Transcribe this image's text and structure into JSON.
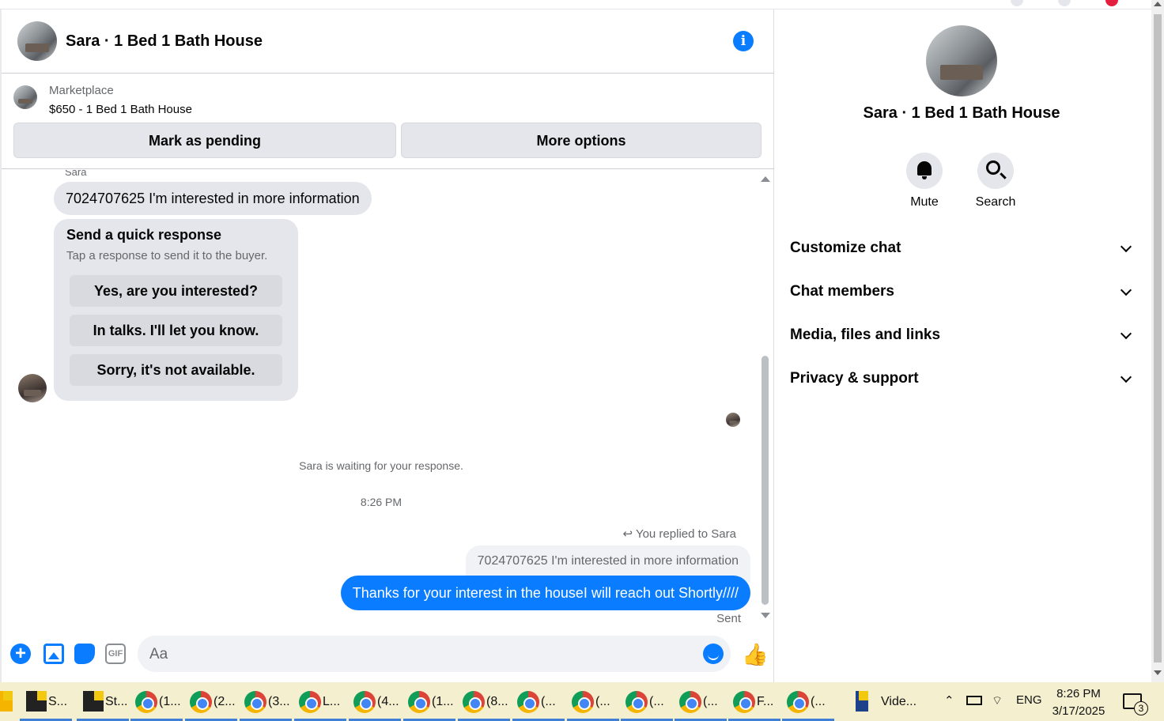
{
  "chat": {
    "title": "Sara · 1 Bed 1 Bath House",
    "listing": {
      "source": "Marketplace",
      "price_title": "$650 - 1 Bed 1 Bath House",
      "mark_pending": "Mark as pending",
      "more_options": "More options"
    },
    "messages": {
      "sender_name": "Sara",
      "incoming": "7024707625 I'm interested in more information",
      "quick_response": {
        "title": "Send a quick response",
        "subtitle": "Tap a response to send it to the buyer.",
        "options": [
          "Yes, are you interested?",
          "In talks. I'll let you know.",
          "Sorry, it's not available."
        ]
      },
      "waiting": "Sara is waiting for your response.",
      "time": "8:26 PM",
      "replied_to": "You replied to Sara",
      "quoted": "7024707625 I'm interested in more information",
      "outgoing": "Thanks for your interest in the houseI will reach out Shortly////",
      "status": "Sent"
    },
    "composer": {
      "placeholder": "Aa",
      "gif_label": "GIF",
      "plus_glyph": "+",
      "like_glyph": "👍"
    },
    "info_glyph": "i"
  },
  "panel": {
    "title": "Sara · 1 Bed 1 Bath House",
    "mute": "Mute",
    "search": "Search",
    "sections": [
      "Customize chat",
      "Chat members",
      "Media, files and links",
      "Privacy & support"
    ]
  },
  "taskbar": {
    "items": [
      {
        "label": "S...",
        "icon": "app-icon"
      },
      {
        "label": "St...",
        "icon": "sticky-notes-icon"
      },
      {
        "label": "(1...",
        "icon": "chrome-icon"
      },
      {
        "label": "(2...",
        "icon": "chrome-icon"
      },
      {
        "label": "(3...",
        "icon": "chrome-icon"
      },
      {
        "label": "L...",
        "icon": "chrome-icon"
      },
      {
        "label": "(4...",
        "icon": "chrome-icon"
      },
      {
        "label": "(1...",
        "icon": "chrome-icon"
      },
      {
        "label": "(8...",
        "icon": "chrome-icon"
      },
      {
        "label": "(...",
        "icon": "chrome-icon"
      },
      {
        "label": "(...",
        "icon": "chrome-icon"
      },
      {
        "label": "(...",
        "icon": "chrome-icon"
      },
      {
        "label": "(...",
        "icon": "chrome-icon"
      },
      {
        "label": "F...",
        "icon": "chrome-icon"
      },
      {
        "label": "(...",
        "icon": "chrome-icon"
      }
    ],
    "video_label": "Vide...",
    "language": "ENG",
    "time": "8:26 PM",
    "date": "3/17/2025",
    "notification_count": "3"
  },
  "colors": {
    "accent": "#0a7cff",
    "bubble_in": "#e4e6eb",
    "taskbar": "#f3efcf"
  }
}
